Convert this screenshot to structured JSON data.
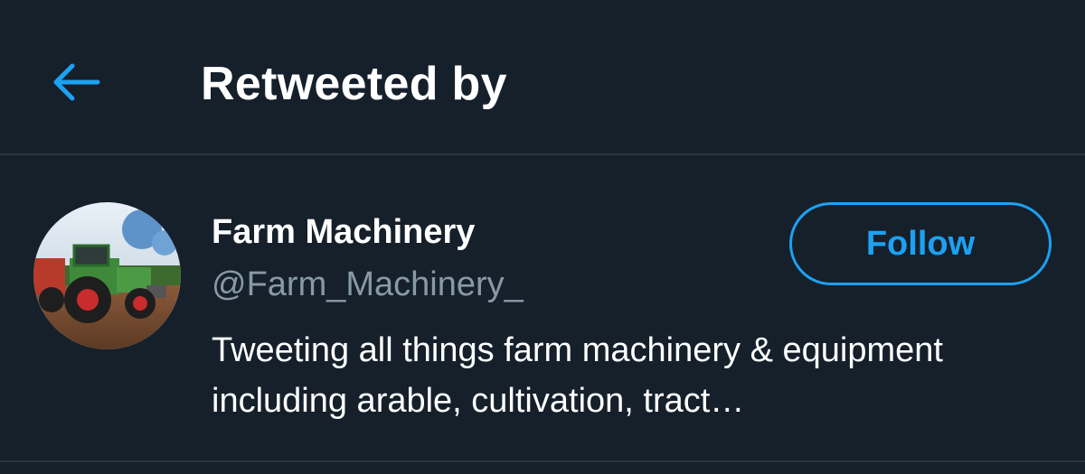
{
  "header": {
    "title": "Retweeted by",
    "back_icon": "arrow-left-icon"
  },
  "user": {
    "name": "Farm Machinery",
    "handle": "@Farm_Machinery_",
    "bio": "Tweeting all things farm machinery & equipment including arable, cultivation, tract…",
    "follow_label": "Follow",
    "avatar_description_icon": "tractor-avatar"
  },
  "colors": {
    "background": "#15202b",
    "accent": "#1da1f2",
    "secondary_text": "#8899a6",
    "divider": "#2c3640"
  }
}
